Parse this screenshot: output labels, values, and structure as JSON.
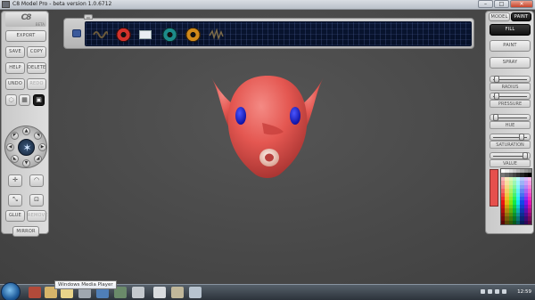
{
  "window": {
    "title": "C8 Model Pro - beta version 1.0.6712"
  },
  "left_panel": {
    "logo_text": "C8",
    "logo_sub": "BETA",
    "export_label": "EXPORT",
    "save_label": "SAVE",
    "copy_label": "COPY",
    "help_label": "HELP",
    "delete_label": "DELETE",
    "undo_label": "UNDO",
    "redo_label": "REDO",
    "glue_label": "GLUE",
    "remove_label": "REMOVE",
    "mirror_label": "MIRROR"
  },
  "right_panel": {
    "model_tab": "MODEL",
    "paint_tab": "PAINT",
    "fill_label": "FILL",
    "paint_label": "PAINT",
    "spray_label": "SPRAY",
    "radius_label": "RADIUS",
    "pressure_label": "PRESSURE",
    "hue_label": "HUE",
    "saturation_label": "SATURATION",
    "value_label": "VALUE",
    "current_color": "#e6504d"
  },
  "taskbar": {
    "tooltip": "Windows Media Player",
    "clock": "12:59"
  },
  "colors": {
    "head": "#e8504c",
    "eyes": "#1416d8",
    "accent_dark": "#1a1a1a"
  }
}
